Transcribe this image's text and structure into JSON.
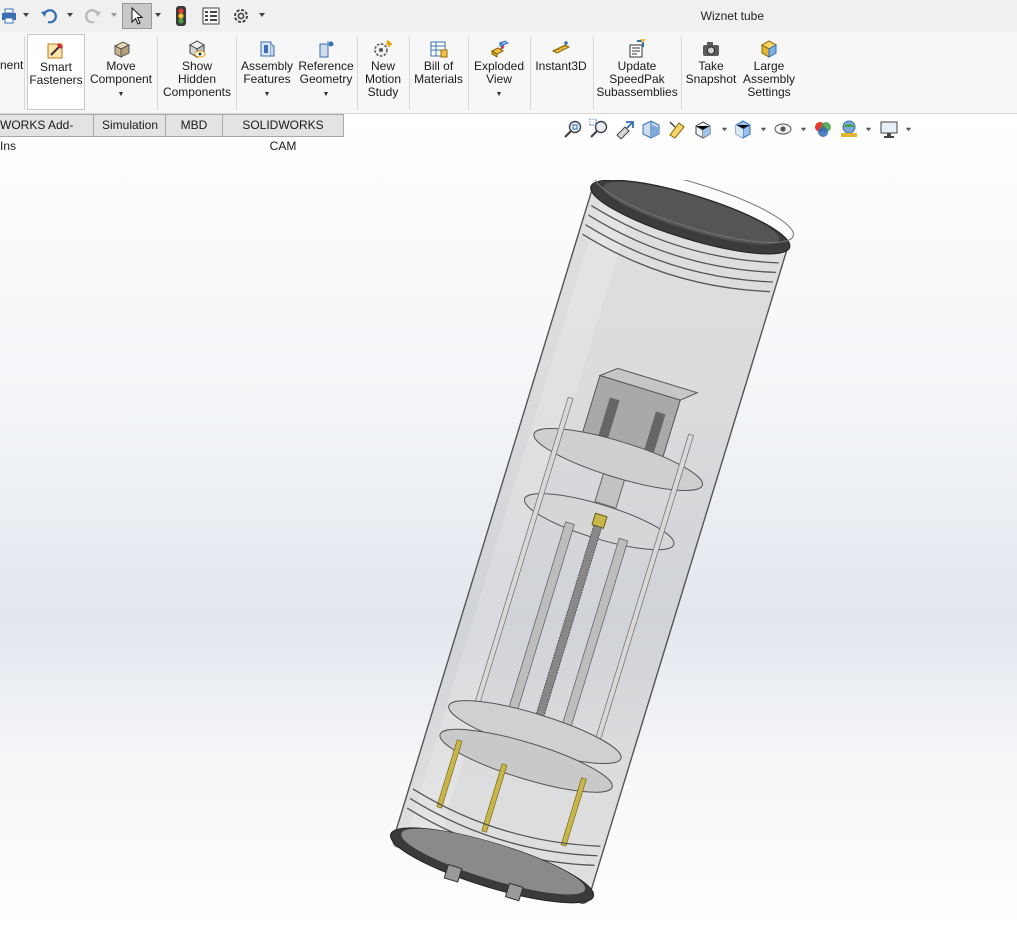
{
  "window": {
    "title": "Wiznet tube"
  },
  "quick_access": {
    "icons": [
      "print-icon",
      "undo-icon",
      "redo-icon",
      "select-icon",
      "rebuild-icon",
      "file-properties-icon",
      "options-icon"
    ]
  },
  "ribbon": {
    "partial_label": "nent",
    "buttons": [
      {
        "id": "smart-fasteners",
        "label": "Smart\nFasteners",
        "icon": "smart-fasteners-icon"
      },
      {
        "id": "move-component",
        "label": "Move\nComponent",
        "icon": "move-component-icon"
      },
      {
        "id": "show-hidden-components",
        "label": "Show\nHidden\nComponents",
        "icon": "show-hidden-icon"
      },
      {
        "id": "assembly-features",
        "label": "Assembly\nFeatures",
        "icon": "assembly-features-icon"
      },
      {
        "id": "reference-geometry",
        "label": "Reference\nGeometry",
        "icon": "reference-geometry-icon"
      },
      {
        "id": "new-motion-study",
        "label": "New\nMotion\nStudy",
        "icon": "motion-study-icon"
      },
      {
        "id": "bill-of-materials",
        "label": "Bill of\nMaterials",
        "icon": "bom-icon"
      },
      {
        "id": "exploded-view",
        "label": "Exploded\nView",
        "icon": "exploded-view-icon"
      },
      {
        "id": "instant3d",
        "label": "Instant3D",
        "icon": "instant3d-icon"
      },
      {
        "id": "update-speedpak",
        "label": "Update\nSpeedPak\nSubassemblies",
        "icon": "speedpak-icon"
      },
      {
        "id": "take-snapshot",
        "label": "Take\nSnapshot",
        "icon": "camera-icon"
      },
      {
        "id": "large-assembly-settings",
        "label": "Large\nAssembly\nSettings",
        "icon": "large-assembly-icon"
      }
    ]
  },
  "tabs": [
    {
      "label": "WORKS Add-Ins"
    },
    {
      "label": "Simulation"
    },
    {
      "label": "MBD"
    },
    {
      "label": "SOLIDWORKS CAM"
    }
  ],
  "heads_up_toolbar": {
    "icons": [
      "zoom-to-fit-icon",
      "zoom-to-area-icon",
      "previous-view-icon",
      "section-view-icon",
      "dynamic-annotation-icon",
      "view-orientation-icon",
      "display-style-icon",
      "hide-show-icon",
      "edit-appearance-icon",
      "apply-scene-icon",
      "view-settings-icon"
    ]
  },
  "model": {
    "name": "tube-assembly"
  }
}
